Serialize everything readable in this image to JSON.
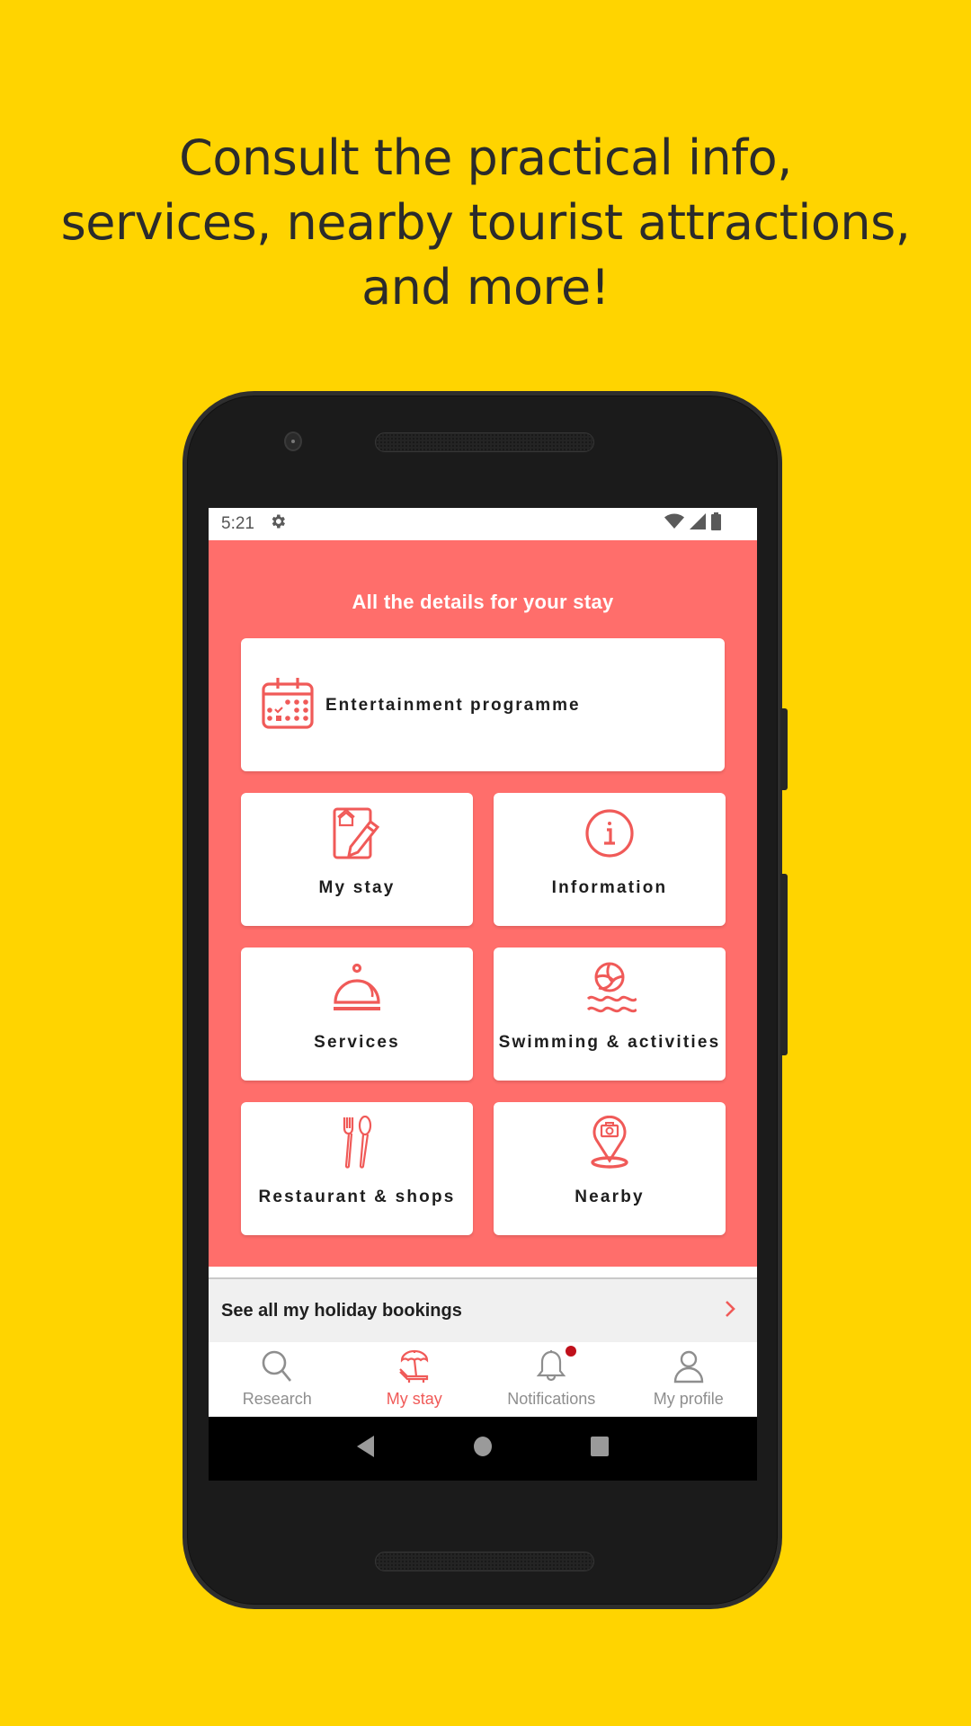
{
  "headline": {
    "lines": [
      "Consult the practical info,",
      "services, nearby tourist attractions,",
      "and more!"
    ]
  },
  "statusbar": {
    "time": "5:21",
    "icons": [
      "settings-icon",
      "wifi-icon",
      "signal-icon",
      "battery-icon"
    ]
  },
  "screen": {
    "title": "All the details for your stay",
    "accent_color": "#FF6E6B",
    "icon_color": "#F05A58",
    "cards": [
      {
        "label": "Entertainment programme",
        "icon": "calendar-icon"
      },
      {
        "label": "My stay",
        "icon": "document-edit-icon"
      },
      {
        "label": "Information",
        "icon": "info-icon"
      },
      {
        "label": "Services",
        "icon": "service-bell-icon"
      },
      {
        "label": "Swimming & activities",
        "icon": "volleyball-water-icon"
      },
      {
        "label": "Restaurant & shops",
        "icon": "fork-spoon-icon"
      },
      {
        "label": "Nearby",
        "icon": "location-camera-icon"
      }
    ],
    "bookings_link": "See all my holiday bookings"
  },
  "bottom_nav": {
    "items": [
      {
        "label": "Research",
        "icon": "search-icon",
        "active": false
      },
      {
        "label": "My stay",
        "icon": "beach-umbrella-icon",
        "active": true
      },
      {
        "label": "Notifications",
        "icon": "bell-icon",
        "active": false,
        "badge": true
      },
      {
        "label": "My profile",
        "icon": "user-icon",
        "active": false
      }
    ]
  },
  "system_nav": [
    "back-icon",
    "home-icon",
    "recents-icon"
  ]
}
